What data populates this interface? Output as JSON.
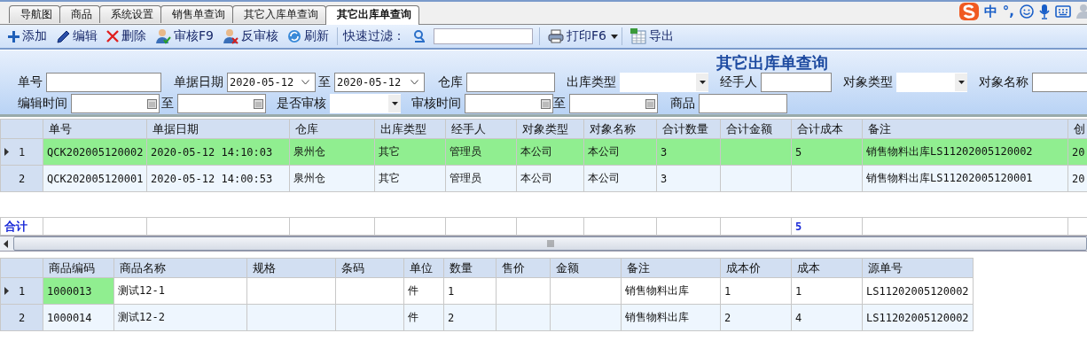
{
  "tabs": [
    {
      "label": "导航图",
      "selected": false
    },
    {
      "label": "商品",
      "selected": false
    },
    {
      "label": "系统设置",
      "selected": false
    },
    {
      "label": "销售单查询",
      "selected": false
    },
    {
      "label": "其它入库单查询",
      "selected": false
    },
    {
      "label": "其它出库单查询",
      "selected": true
    }
  ],
  "ime_bar": {
    "mode": "中",
    "punctuation": "°,"
  },
  "toolbar": [
    {
      "kind": "add",
      "label": "添加"
    },
    {
      "kind": "edit",
      "label": "编辑"
    },
    {
      "kind": "delete",
      "label": "删除"
    },
    {
      "kind": "approve",
      "label": "审核F9"
    },
    {
      "kind": "unapprove",
      "label": "反审核"
    },
    {
      "kind": "refresh",
      "label": "刷新"
    }
  ],
  "quick_filter": {
    "label": "快速过滤："
  },
  "print": {
    "label": "打印F6"
  },
  "export": {
    "label": "导出"
  },
  "filter_panel": {
    "title": "其它出库单查询",
    "rows": [
      [
        {
          "label": "单号",
          "kind": "text"
        },
        {
          "label": "单据日期",
          "kind": "date",
          "value": "2020-05-12"
        },
        {
          "label": "至",
          "kind": "date",
          "value": "2020-05-12"
        },
        {
          "label": "仓库",
          "kind": "text"
        },
        {
          "label": "出库类型",
          "kind": "select"
        },
        {
          "label": "经手人",
          "kind": "text"
        },
        {
          "label": "对象类型",
          "kind": "select"
        },
        {
          "label": "对象名称",
          "kind": "text"
        }
      ],
      [
        {
          "label": "编辑时间",
          "kind": "calendar"
        },
        {
          "label": "至",
          "kind": "calendar"
        },
        {
          "label": "是否审核",
          "kind": "select"
        },
        {
          "label": "审核时间",
          "kind": "calendar"
        },
        {
          "label": "至",
          "kind": "calendar"
        },
        {
          "label": "商品",
          "kind": "text"
        }
      ]
    ]
  },
  "orders": {
    "columns": [
      "单号",
      "单据日期",
      "仓库",
      "出库类型",
      "经手人",
      "对象类型",
      "对象名称",
      "合计数量",
      "合计金额",
      "合计成本",
      "备注",
      "创"
    ],
    "rows": [
      {
        "number": "1",
        "selected": true,
        "cells": [
          "QCK202005120002",
          "2020-05-12 14:10:03",
          "泉州仓",
          "其它",
          "管理员",
          "本公司",
          "本公司",
          "3",
          null,
          "5",
          "销售物料出库LS11202005120002",
          "20"
        ]
      },
      {
        "number": "2",
        "selected": false,
        "cells": [
          "QCK202005120001",
          "2020-05-12 14:00:53",
          "泉州仓",
          "其它",
          "管理员",
          "本公司",
          "本公司",
          "3",
          null,
          null,
          "销售物料出库LS11202005120001",
          "20"
        ]
      }
    ],
    "totals": {
      "label": "合计",
      "total_cost": "5"
    }
  },
  "items": {
    "columns": [
      "商品编码",
      "商品名称",
      "规格",
      "条码",
      "单位",
      "数量",
      "售价",
      "金额",
      "备注",
      "成本价",
      "成本",
      "源单号"
    ],
    "rows": [
      {
        "number": "1",
        "selected": true,
        "cells": [
          "1000013",
          "测试12-1",
          null,
          null,
          "件",
          "1",
          null,
          null,
          "销售物料出库",
          "1",
          "1",
          "LS11202005120002"
        ]
      },
      {
        "number": "2",
        "selected": false,
        "cells": [
          "1000014",
          "测试12-2",
          null,
          null,
          "件",
          "2",
          null,
          null,
          "销售物料出库",
          "2",
          "4",
          "LS11202005120002"
        ]
      }
    ]
  }
}
